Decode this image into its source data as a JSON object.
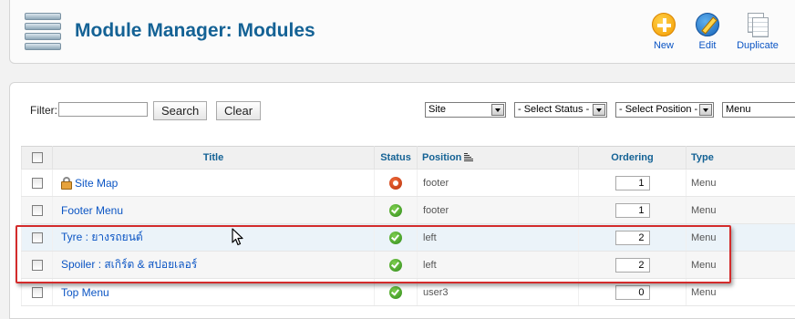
{
  "header": {
    "title": "Module Manager: Modules",
    "toolbar": {
      "new_label": "New",
      "edit_label": "Edit",
      "duplicate_label": "Duplicate"
    }
  },
  "filters": {
    "filter_label": "Filter:",
    "filter_value": "",
    "search_label": "Search",
    "clear_label": "Clear",
    "site_select": "Site",
    "status_select": "- Select Status -",
    "position_select": "- Select Position -",
    "type_select": "Menu"
  },
  "table": {
    "columns": {
      "title": "Title",
      "status": "Status",
      "position": "Position",
      "ordering": "Ordering",
      "type": "Type"
    },
    "rows": [
      {
        "title": "Site Map",
        "status": "unpublished",
        "position": "footer",
        "ordering": "1",
        "type": "Menu",
        "locked": true
      },
      {
        "title": "Footer Menu",
        "status": "published",
        "position": "footer",
        "ordering": "1",
        "type": "Menu"
      },
      {
        "title": "Tyre : ยางรถยนต์",
        "status": "published",
        "position": "left",
        "ordering": "2",
        "type": "Menu"
      },
      {
        "title": "Spoiler : สเกิร์ต & สปอยเลอร์",
        "status": "published",
        "position": "left",
        "ordering": "2",
        "type": "Menu"
      },
      {
        "title": "Top Menu",
        "status": "published",
        "position": "user3",
        "ordering": "0",
        "type": "Menu"
      }
    ]
  },
  "colors": {
    "title_blue": "#146295",
    "link_blue": "#0b55c4",
    "highlight_red": "#d32b2b",
    "status_green": "#2f8a1a",
    "status_red": "#b7310b"
  },
  "icons": [
    "logo-stack-icon",
    "new-plus-icon",
    "edit-pencil-icon",
    "duplicate-copy-icon",
    "lock-icon",
    "sort-icon",
    "published-check-icon",
    "unpublished-icon",
    "mouse-cursor-icon"
  ]
}
